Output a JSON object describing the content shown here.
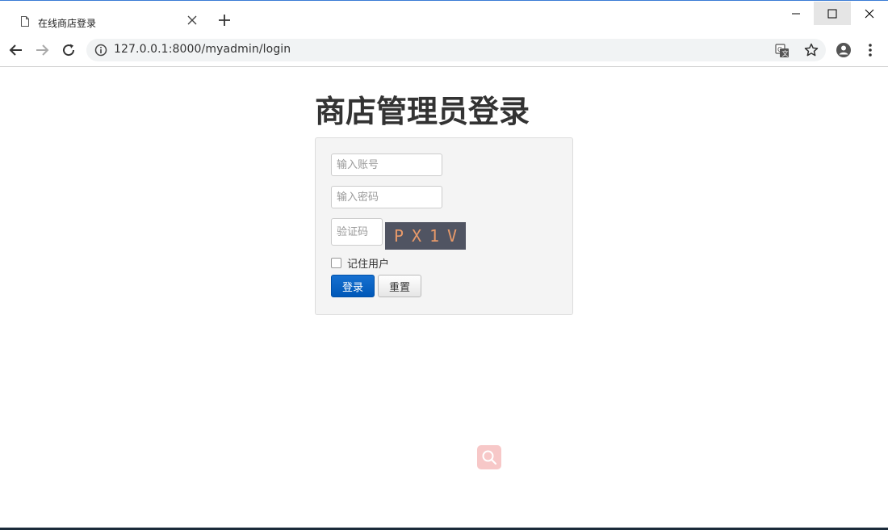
{
  "tab": {
    "title": "在线商店登录",
    "page_icon": "page-icon",
    "close_icon": "close-icon",
    "new_tab_icon": "plus-icon"
  },
  "window_controls": {
    "minimize_icon": "minimize-icon",
    "maximize_icon": "maximize-icon",
    "close_icon": "close-icon"
  },
  "toolbar": {
    "back_icon": "arrow-left-icon",
    "forward_icon": "arrow-right-icon",
    "reload_icon": "reload-icon",
    "site_info_icon": "info-icon",
    "url": "127.0.0.1:8000/myadmin/login",
    "translate_icon": "translate-icon",
    "bookmark_icon": "star-icon",
    "profile_icon": "account-icon",
    "menu_icon": "kebab-menu-icon"
  },
  "page": {
    "title": "商店管理员登录",
    "form": {
      "account_placeholder": "输入账号",
      "password_placeholder": "输入密码",
      "captcha_placeholder": "验证码",
      "captcha_chars": [
        "P",
        "X",
        "1",
        "V"
      ],
      "remember_label": "记住用户",
      "remember_checked": false,
      "login_label": "登录",
      "reset_label": "重置"
    },
    "floating_button_icon": "search-icon"
  },
  "colors": {
    "login_button": "#0058b8",
    "captcha_background": "#505462",
    "captcha_text": "#e89a6a",
    "floating_button": "#f7c8c8"
  }
}
